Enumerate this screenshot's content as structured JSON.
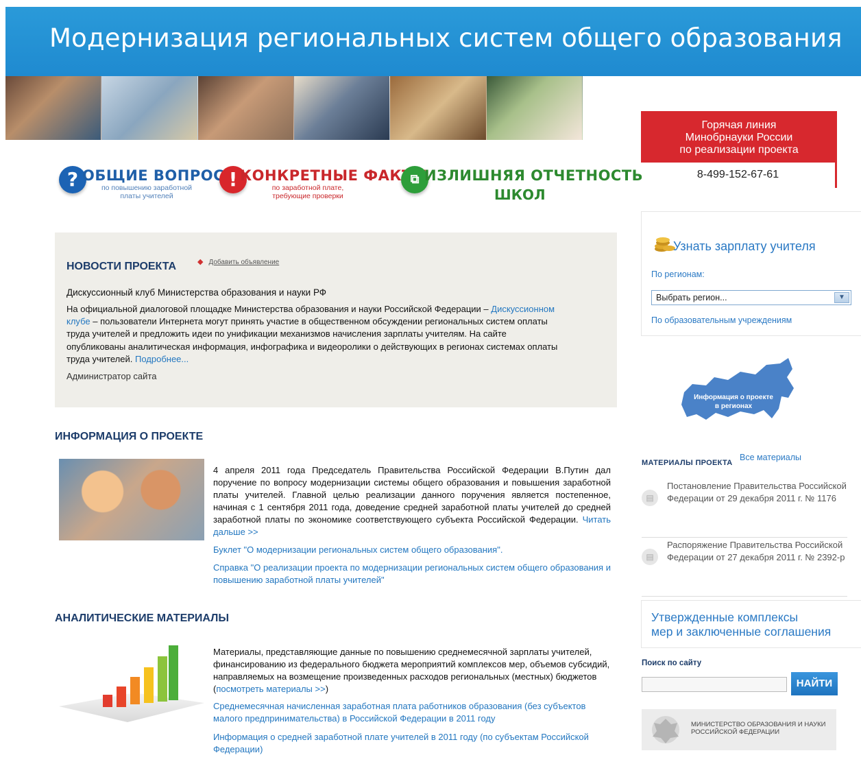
{
  "header": {
    "title": "Модернизация региональных систем общего образования"
  },
  "categories": [
    {
      "icon": "question-icon",
      "badge": "?",
      "title": "ОБЩИЕ ВОПРОСЫ",
      "subtitle_line1": "по повышению заработной",
      "subtitle_line2": "платы учителей",
      "color": "#1f5fa8"
    },
    {
      "icon": "exclamation-icon",
      "badge": "!",
      "title": "КОНКРЕТНЫЕ ФАКТЫ",
      "subtitle_line1": "по заработной плате,",
      "subtitle_line2": "требующие проверки",
      "color": "#c9272b"
    },
    {
      "icon": "documents-icon",
      "badge": "⧉",
      "title": "ИЗЛИШНЯЯ ОТЧЕТНОСТЬ",
      "subtitle_line1": "ШКОЛ",
      "color": "#2d8a2f"
    }
  ],
  "news": {
    "title": "НОВОСТИ ПРОЕКТА",
    "add_link": "Добавить объявление",
    "headline": "Дискуссионный клуб Министерства образования и науки РФ",
    "body_pre": "На официальной диалоговой площадке Министерства образования и науки Российской Федерации – ",
    "body_link": "Дискуссионном клубе",
    "body_post": " – пользователи Интернета могут принять участие в общественном обсуждении региональных систем оплаты труда учителей и предложить идеи по унификации механизмов начисления зарплаты учителям. На сайте опубликованы аналитическая информация, инфографика и видеоролики о действующих в регионах системах оплаты труда учителей. ",
    "more_link": "Подробнее...",
    "author": "Администратор сайта"
  },
  "about": {
    "title": "ИНФОРМАЦИЯ О ПРОЕКТЕ",
    "text": "4 апреля 2011 года Председатель Правительства Российской Федерации В.Путин дал поручение по вопросу модернизации системы общего образования и повышения заработной платы учителей. Главной целью реализации данного поручения является постепенное, начиная с 1 сентября 2011 года, доведение средней заработной платы учителей до средней заработной платы по экономике соответствующего субъекта Российской Федерации. ",
    "read_more": "Читать дальше >>",
    "link1": "Буклет \"О модернизации региональных систем общего образования\".",
    "link2": "Справка \"О реализации проекта по модернизации региональных систем общего образования и повышению заработной платы учителей\""
  },
  "analytics": {
    "title": "АНАЛИТИЧЕСКИЕ МАТЕРИАЛЫ",
    "text": "Материалы, представляющие данные по повышению среднемесячной зарплаты учителей, финансированию из федерального бюджета мероприятий комплексов мер, объемов субсидий, направляемых на возмещение произведенных расходов региональных (местных) бюджетов (",
    "text_link": "посмотреть материалы >>",
    "text_end": ")",
    "link1": "Среднемесячная начисленная заработная плата работников образования (без субъектов малого предпринимательства) в Российской Федерации в 2011 году",
    "link2": "Информация о средней заработной плате учителей в 2011 году (по субъектам Российской Федерации)"
  },
  "hotline": {
    "line1": "Горячая линия",
    "line2": "Минобрнауки России",
    "line3": "по реализации проекта",
    "phone": "8-499-152-67-61"
  },
  "salary": {
    "title": "Узнать зарплату учителя",
    "by_region": "По регионам:",
    "select_value": "Выбрать регион...",
    "by_institution": "По образовательным учреждениям"
  },
  "map": {
    "label_line1": "Информация о проекте",
    "label_line2": "в регионах"
  },
  "materials": {
    "title": "МАТЕРИАЛЫ ПРОЕКТА",
    "all_link": "Все материалы",
    "items": [
      {
        "text": "Постановление Правительства Российской Федерации от 29 декабря 2011 г. № 1176"
      },
      {
        "text": "Распоряжение Правительства Российской Федерации от 27 декабря 2011 г. № 2392-р"
      }
    ]
  },
  "approved": {
    "line1": "Утвержденные комплексы",
    "line2": "мер и заключенные соглашения"
  },
  "search": {
    "label": "Поиск по сайту",
    "value": "",
    "button": "НАЙТИ"
  },
  "ministry": {
    "line1": "МИНИСТЕРСТВО ОБРАЗОВАНИЯ И НАУКИ",
    "line2": "РОССИЙСКОЙ ФЕДЕРАЦИИ"
  }
}
